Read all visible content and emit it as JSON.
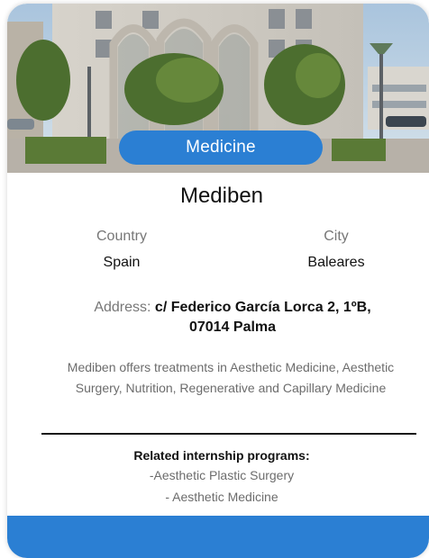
{
  "hero": {
    "image_icon": "building-photo",
    "category": "Medicine"
  },
  "center": {
    "name": "Mediben",
    "country_label": "Country",
    "country_value": "Spain",
    "city_label": "City",
    "city_value": "Baleares",
    "address_label": "Address:",
    "address_line1": "c/ Federico García Lorca 2, 1ºB,",
    "address_line2": "07014 Palma",
    "description_line1": "Mediben offers treatments in Aesthetic Medicine, Aesthetic",
    "description_line2": "Surgery, Nutrition, Regenerative and Capillary Medicine"
  },
  "related": {
    "title": "Related internship programs:",
    "items": [
      "-Aesthetic Plastic Surgery",
      "- Aesthetic Medicine"
    ]
  },
  "colors": {
    "accent": "#2b7fd3",
    "text_primary": "#111111",
    "text_muted": "#777777"
  }
}
